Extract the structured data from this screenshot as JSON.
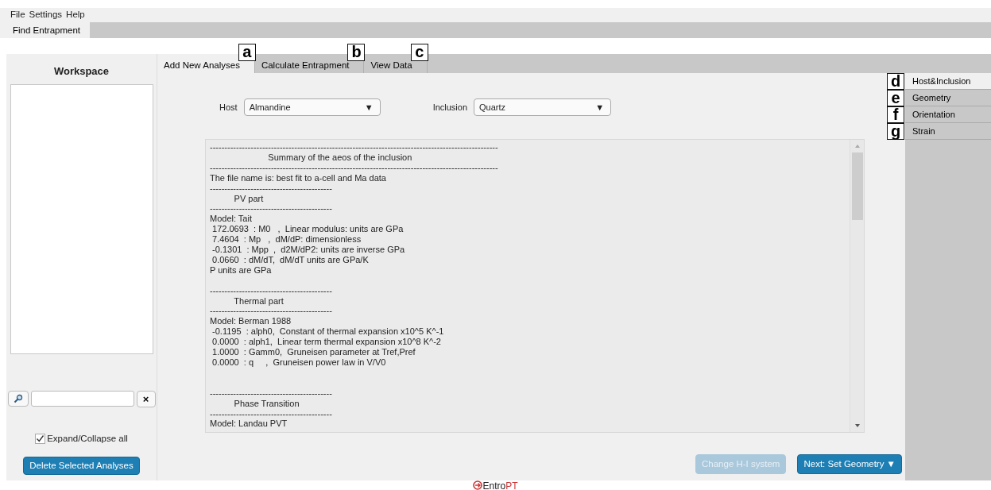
{
  "menu": [
    "File",
    "Settings",
    "Help"
  ],
  "window_tabs": [
    {
      "label": "Find Entrapment",
      "selected": true
    }
  ],
  "workspace": {
    "title": "Workspace",
    "search": {
      "clear": "×"
    },
    "expand_all": {
      "label": "Expand/Collapse all",
      "checked": true
    },
    "delete_button": "Delete Selected Analyses"
  },
  "tabs": [
    {
      "label": "Add New Analyses",
      "selected": true,
      "callout": "a"
    },
    {
      "label": "Calculate Entrapment",
      "selected": false,
      "callout": "b"
    },
    {
      "label": "View Data",
      "selected": false,
      "callout": "c"
    }
  ],
  "host": {
    "label": "Host",
    "value": "Almandine",
    "caret": "▼"
  },
  "inclusion": {
    "label": "Inclusion",
    "value": "Quartz",
    "caret": "▼"
  },
  "summary_lines": [
    {
      "text": "---------------------------------------------------------------------------------------------------",
      "kind": "line"
    },
    {
      "text": "                        Summary of the aeos of the inclusion",
      "kind": "line"
    },
    {
      "text": "---------------------------------------------------------------------------------------------------",
      "kind": "line"
    },
    {
      "text": "The file name is: best fit to a-cell and Ma data",
      "kind": "line"
    },
    {
      "text": "------------------------------------------",
      "kind": "line"
    },
    {
      "text": "          PV part",
      "kind": "line"
    },
    {
      "text": "------------------------------------------",
      "kind": "line"
    },
    {
      "text": "Model: Tait",
      "kind": "line"
    },
    {
      "text": " 172.0693  : M0   ,  Linear modulus: units are GPa",
      "kind": "line"
    },
    {
      "text": " 7.4604  : Mp   ,  dM/dP: dimensionless",
      "kind": "line"
    },
    {
      "text": " -0.1301  : Mpp  ,  d2M/dP2: units are inverse GPa",
      "kind": "line"
    },
    {
      "text": " 0.0660  : dM/dT,  dM/dT units are GPa/K",
      "kind": "line"
    },
    {
      "text": "P units are GPa",
      "kind": "line"
    },
    {
      "text": "------------------------------------------",
      "kind": "after_gap"
    },
    {
      "text": "          Thermal part",
      "kind": "line"
    },
    {
      "text": "------------------------------------------",
      "kind": "line"
    },
    {
      "text": "Model: Berman 1988",
      "kind": "line"
    },
    {
      "text": " -0.1195  : alph0,  Constant of thermal expansion x10^5 K^-1",
      "kind": "line"
    },
    {
      "text": " 0.0000  : alph1,  Linear term thermal expansion x10^8 K^-2",
      "kind": "line"
    },
    {
      "text": " 1.0000  : Gamm0,  Gruneisen parameter at Tref,Pref",
      "kind": "line"
    },
    {
      "text": " 0.0000  : q     ,  Gruneisen power law in V/V0",
      "kind": "line"
    },
    {
      "text": "------------------------------------------",
      "kind": "after_wide_gap"
    },
    {
      "text": "          Phase Transition",
      "kind": "line"
    },
    {
      "text": "------------------------------------------",
      "kind": "line"
    },
    {
      "text": "Model: Landau PVT",
      "kind": "line"
    }
  ],
  "buttons": [
    {
      "label": "Change H-I system",
      "disabled": true
    },
    {
      "label": "Next: Set Geometry ▼",
      "disabled": false
    }
  ],
  "side_tabs": [
    {
      "label": "Host&Inclusion",
      "selected": true,
      "callout": "d"
    },
    {
      "label": "Geometry",
      "selected": false,
      "callout": "e"
    },
    {
      "label": "Orientation",
      "selected": false,
      "callout": "f"
    },
    {
      "label": "Strain",
      "selected": false,
      "callout": "g"
    }
  ],
  "footer": {
    "logo_start": "Entro",
    "logo_end": "PT"
  }
}
